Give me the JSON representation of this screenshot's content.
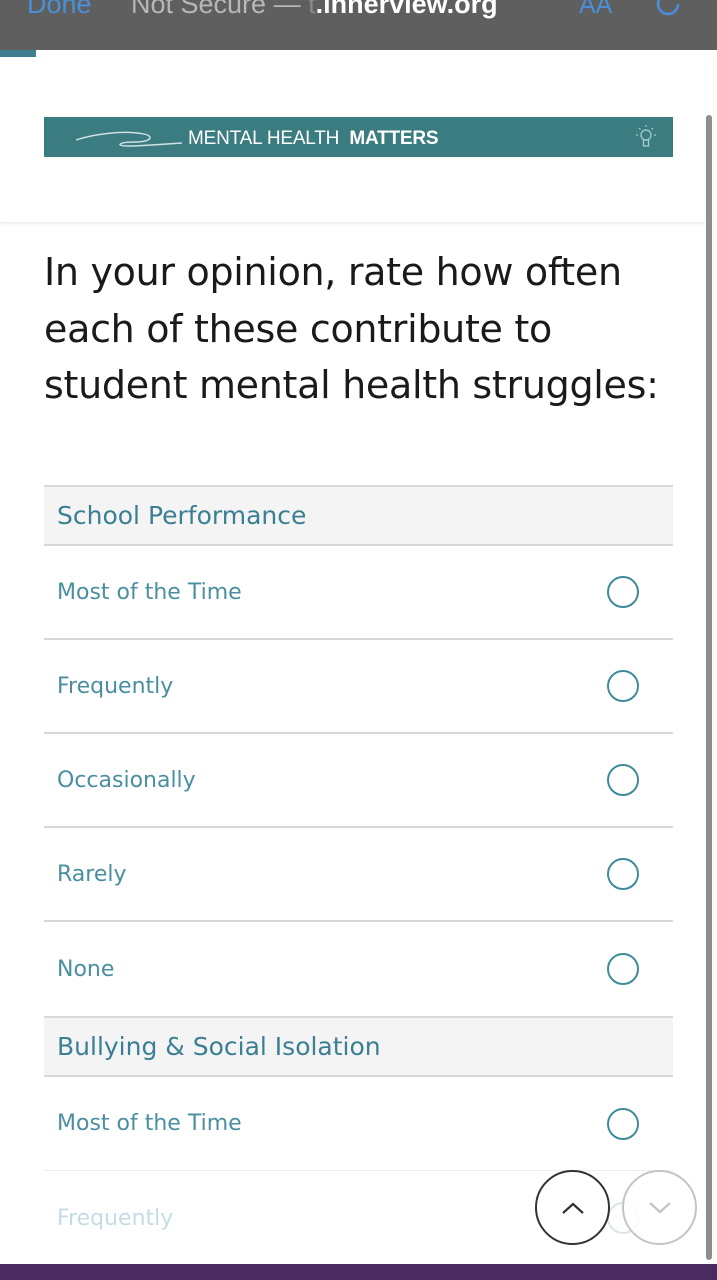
{
  "browser": {
    "done_label": "Done",
    "not_secure_label": "Not Secure —",
    "domain_prefix": "t",
    "domain": ".innerview.org",
    "text_size_label": "AA",
    "reload_icon": "reload-icon"
  },
  "banner": {
    "text_regular": "MENTAL HEALTH",
    "text_bold": "MATTERS",
    "logo_icon": "swoosh-logo-icon",
    "bulb_icon": "lightbulb-icon",
    "color": "#3b7c80"
  },
  "question": {
    "text": "In your opinion, rate how often each of these contribute to student mental health struggles:"
  },
  "sections": [
    {
      "title": "School Performance",
      "options": [
        "Most of the Time",
        "Frequently",
        "Occasionally",
        "Rarely",
        "None"
      ]
    },
    {
      "title": "Bullying & Social Isolation",
      "options": [
        "Most of the Time",
        "Frequently"
      ]
    }
  ],
  "nav": {
    "up_icon": "chevron-up-icon",
    "down_icon": "chevron-down-icon"
  },
  "colors": {
    "accent": "#3b7f93",
    "radio_border": "#3f8a9b",
    "section_bg": "#f4f4f4",
    "footer": "#4a2b5f"
  }
}
